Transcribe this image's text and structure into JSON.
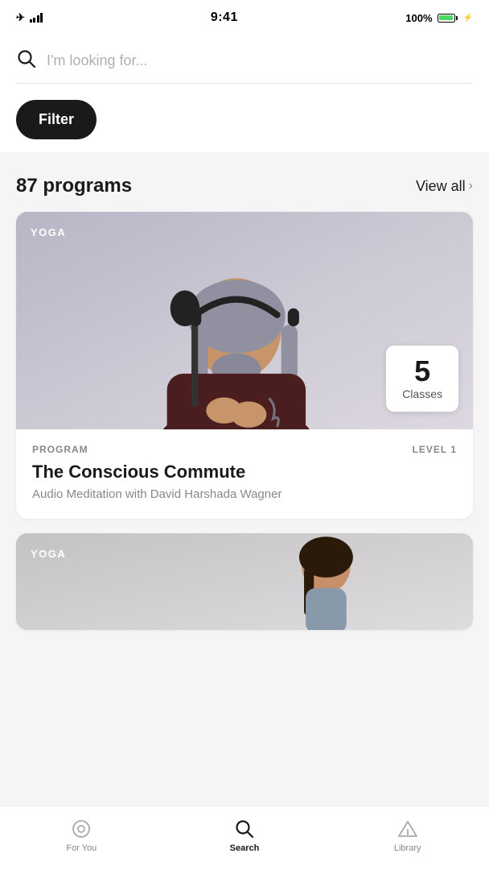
{
  "statusBar": {
    "time": "9:41",
    "battery": "100%",
    "signal": "full"
  },
  "search": {
    "placeholder": "I'm looking for...",
    "filterLabel": "Filter"
  },
  "programs": {
    "count": "87 programs",
    "viewAllLabel": "View all"
  },
  "cards": [
    {
      "category": "YOGA",
      "classesCount": "5",
      "classesLabel": "Classes",
      "programLabel": "PROGRAM",
      "level": "LEVEL 1",
      "title": "The Conscious Commute",
      "subtitle": "Audio Meditation with David Harshada Wagner"
    },
    {
      "category": "YOGA"
    }
  ],
  "bottomNav": {
    "items": [
      {
        "id": "for-you",
        "label": "For You",
        "active": false
      },
      {
        "id": "search",
        "label": "Search",
        "active": true
      },
      {
        "id": "library",
        "label": "Library",
        "active": false
      }
    ]
  }
}
